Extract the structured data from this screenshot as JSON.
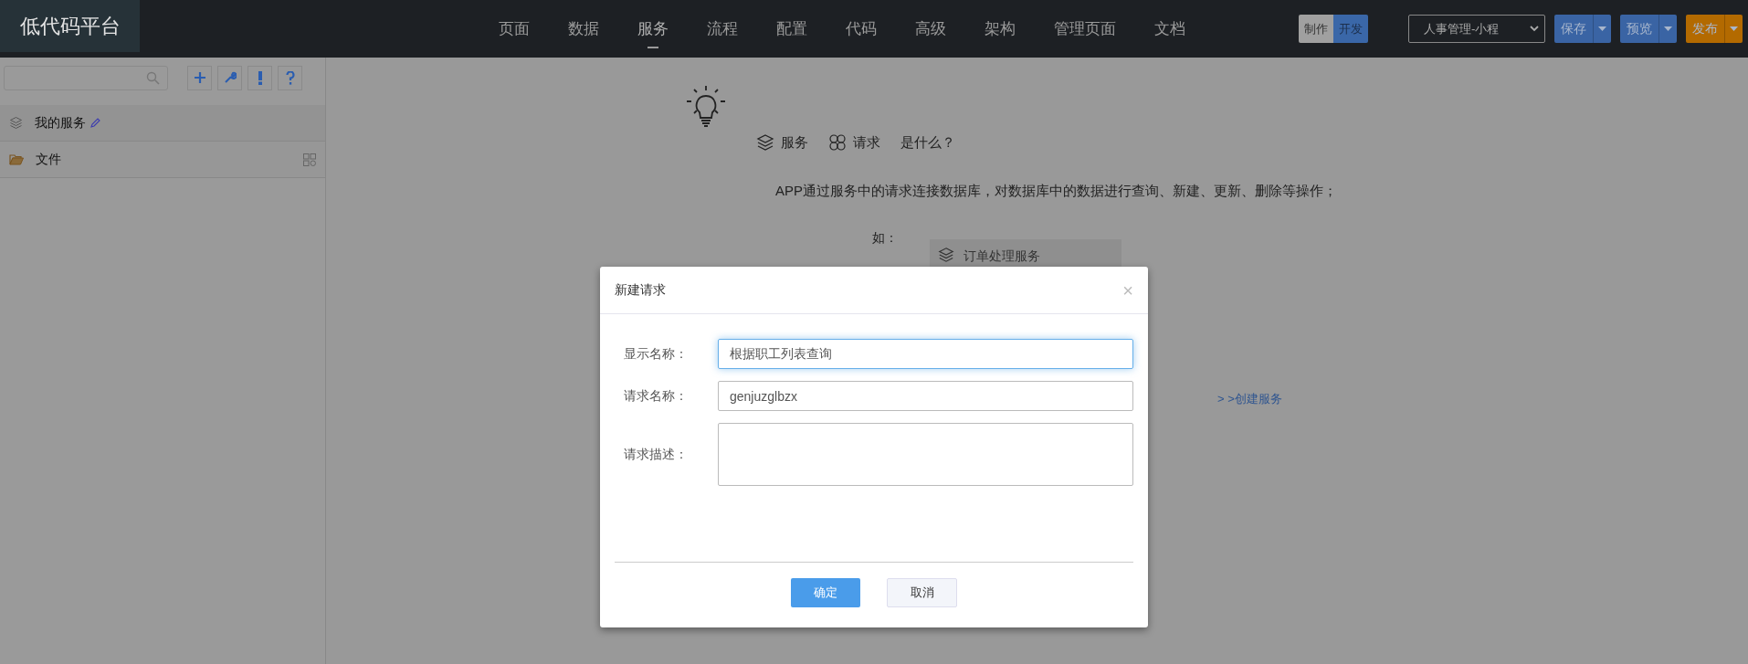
{
  "app": {
    "logo": "低代码平台"
  },
  "nav": [
    {
      "label": "页面",
      "selected": false
    },
    {
      "label": "数据",
      "selected": false
    },
    {
      "label": "服务",
      "selected": true
    },
    {
      "label": "流程",
      "selected": false
    },
    {
      "label": "配置",
      "selected": false
    },
    {
      "label": "代码",
      "selected": false
    },
    {
      "label": "高级",
      "selected": false
    },
    {
      "label": "架构",
      "selected": false
    },
    {
      "label": "管理页面",
      "selected": false
    },
    {
      "label": "文档",
      "selected": false
    }
  ],
  "mode_toggle": [
    {
      "label": "制作",
      "selected": false
    },
    {
      "label": "开发",
      "selected": true
    }
  ],
  "project_select": {
    "value": "人事管理-小程"
  },
  "actions": [
    {
      "label": "保存",
      "color": "#3a64a4"
    },
    {
      "label": "预览",
      "color": "#3a64a4"
    },
    {
      "label": "发布",
      "color": "#b36a00"
    }
  ],
  "sidebar": {
    "toolbar": [
      {
        "kind": "add"
      },
      {
        "kind": "tool"
      },
      {
        "kind": "alert"
      },
      {
        "kind": "help"
      }
    ],
    "items": [
      {
        "kind": "service",
        "label": "我的服务"
      },
      {
        "kind": "folder",
        "label": "文件"
      }
    ]
  },
  "intro": {
    "items": [
      {
        "kind": "service",
        "label": "服务"
      },
      {
        "kind": "request",
        "label": "请求"
      }
    ],
    "suffix": "是什么？",
    "description": "APP通过服务中的请求连接数据库，对数据库中的数据进行查询、新建、更新、删除等操作；",
    "example_label": "如：",
    "example_item": "订单处理服务",
    "create_link": "> >创建服务"
  },
  "dialog": {
    "title": "新建请求",
    "close": "×",
    "fields": [
      {
        "kind": "input",
        "label": "显示名称：",
        "value": "根据职工列表查询",
        "focused": true
      },
      {
        "kind": "input",
        "label": "请求名称：",
        "value": "genjuzglbzx",
        "focused": false
      },
      {
        "kind": "textarea",
        "label": "请求描述：",
        "focused": false
      }
    ],
    "buttons": [
      {
        "kind": "primary",
        "label": "确定"
      },
      {
        "kind": "secondary",
        "label": "取消"
      }
    ]
  }
}
